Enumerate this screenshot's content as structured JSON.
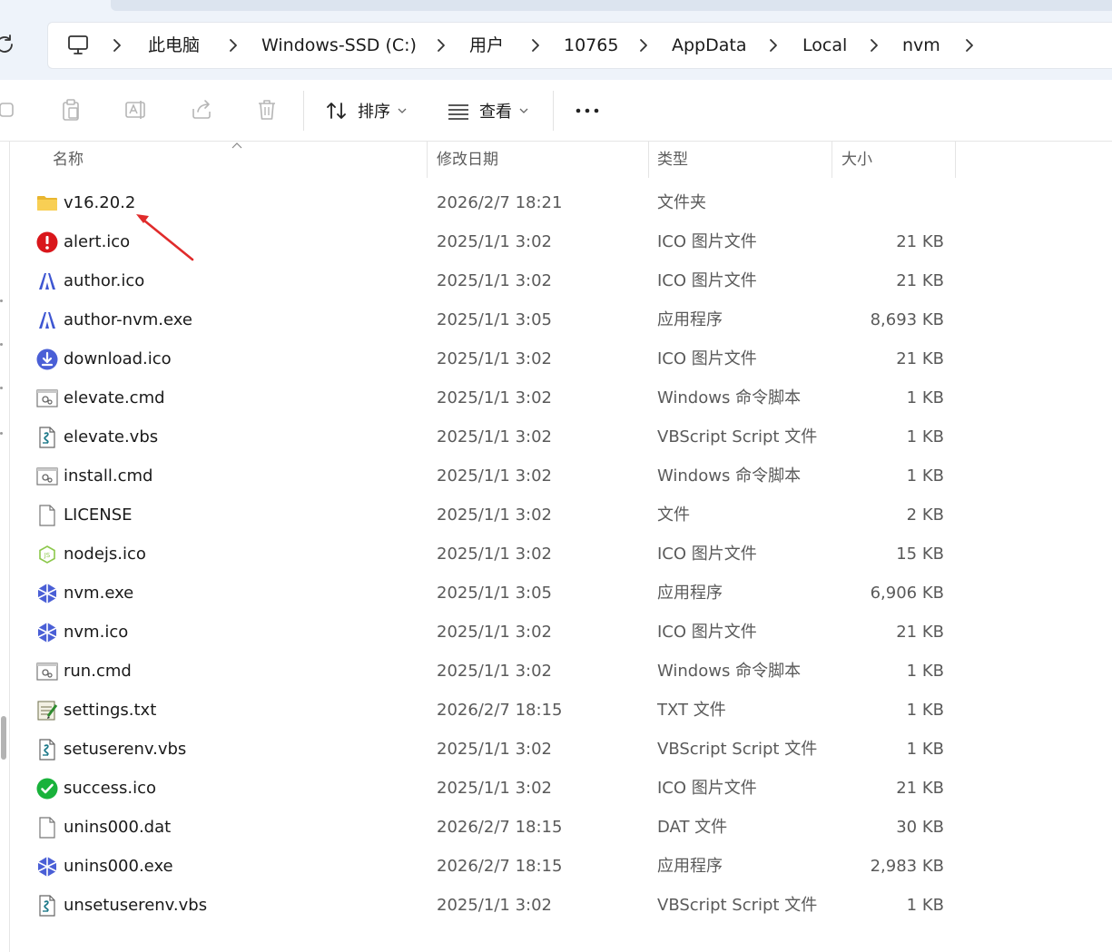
{
  "address": {
    "crumbs": [
      "此电脑",
      "Windows-SSD (C:)",
      "用户",
      "10765",
      "AppData",
      "Local",
      "nvm"
    ]
  },
  "toolbar": {
    "sort_label": "排序",
    "view_label": "查看",
    "more_label": "..."
  },
  "columns": {
    "name": "名称",
    "date": "修改日期",
    "type": "类型",
    "size": "大小"
  },
  "files": [
    {
      "name": "v16.20.2",
      "date": "2026/2/7 18:21",
      "type": "文件夹",
      "size": "",
      "icon": "folder-icon"
    },
    {
      "name": "alert.ico",
      "date": "2025/1/1 3:02",
      "type": "ICO 图片文件",
      "size": "21 KB",
      "icon": "alert-icon"
    },
    {
      "name": "author.ico",
      "date": "2025/1/1 3:02",
      "type": "ICO 图片文件",
      "size": "21 KB",
      "icon": "author-icon"
    },
    {
      "name": "author-nvm.exe",
      "date": "2025/1/1 3:05",
      "type": "应用程序",
      "size": "8,693 KB",
      "icon": "author-icon"
    },
    {
      "name": "download.ico",
      "date": "2025/1/1 3:02",
      "type": "ICO 图片文件",
      "size": "21 KB",
      "icon": "download-icon"
    },
    {
      "name": "elevate.cmd",
      "date": "2025/1/1 3:02",
      "type": "Windows 命令脚本",
      "size": "1 KB",
      "icon": "cmd-file-icon"
    },
    {
      "name": "elevate.vbs",
      "date": "2025/1/1 3:02",
      "type": "VBScript Script 文件",
      "size": "1 KB",
      "icon": "vbs-file-icon"
    },
    {
      "name": "install.cmd",
      "date": "2025/1/1 3:02",
      "type": "Windows 命令脚本",
      "size": "1 KB",
      "icon": "cmd-file-icon"
    },
    {
      "name": "LICENSE",
      "date": "2025/1/1 3:02",
      "type": "文件",
      "size": "2 KB",
      "icon": "blank-file-icon"
    },
    {
      "name": "nodejs.ico",
      "date": "2025/1/1 3:02",
      "type": "ICO 图片文件",
      "size": "15 KB",
      "icon": "nodejs-icon"
    },
    {
      "name": "nvm.exe",
      "date": "2025/1/1 3:05",
      "type": "应用程序",
      "size": "6,906 KB",
      "icon": "nvm-icon"
    },
    {
      "name": "nvm.ico",
      "date": "2025/1/1 3:02",
      "type": "ICO 图片文件",
      "size": "21 KB",
      "icon": "nvm-icon"
    },
    {
      "name": "run.cmd",
      "date": "2025/1/1 3:02",
      "type": "Windows 命令脚本",
      "size": "1 KB",
      "icon": "cmd-file-icon"
    },
    {
      "name": "settings.txt",
      "date": "2026/2/7 18:15",
      "type": "TXT 文件",
      "size": "1 KB",
      "icon": "txt-file-icon"
    },
    {
      "name": "setuserenv.vbs",
      "date": "2025/1/1 3:02",
      "type": "VBScript Script 文件",
      "size": "1 KB",
      "icon": "vbs-file-icon"
    },
    {
      "name": "success.ico",
      "date": "2025/1/1 3:02",
      "type": "ICO 图片文件",
      "size": "21 KB",
      "icon": "success-icon"
    },
    {
      "name": "unins000.dat",
      "date": "2026/2/7 18:15",
      "type": "DAT 文件",
      "size": "30 KB",
      "icon": "blank-file-icon"
    },
    {
      "name": "unins000.exe",
      "date": "2026/2/7 18:15",
      "type": "应用程序",
      "size": "2,983 KB",
      "icon": "nvm-icon"
    },
    {
      "name": "unsetuserenv.vbs",
      "date": "2025/1/1 3:02",
      "type": "VBScript Script 文件",
      "size": "1 KB",
      "icon": "vbs-file-icon"
    }
  ],
  "colors": {
    "folder": "#f4c542",
    "alert": "#d9161b",
    "nvm_blue": "#4a5fd6",
    "success": "#19b23b",
    "annotation": "#e02b2b"
  }
}
